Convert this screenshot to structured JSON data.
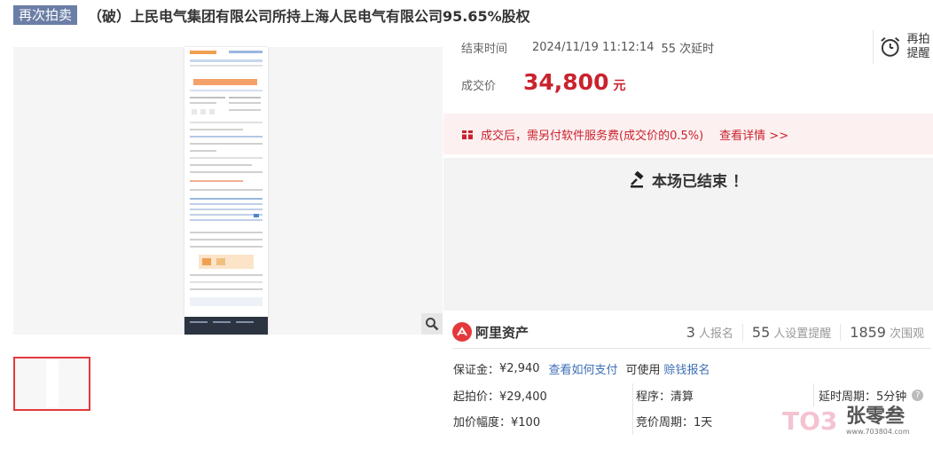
{
  "header": {
    "badge": "再次拍卖",
    "title": "（破）上民电气集团有限公司所持上海人民电气有限公司95.65%股权"
  },
  "auction": {
    "end_label": "结束时间",
    "end_time": "2024/11/19 11:12:14",
    "delay_count": "55 次延时",
    "reminder_label": "再拍提醒",
    "price_label": "成交价",
    "price_value": "34,800",
    "price_unit": "元",
    "fee_notice": "成交后，需另付软件服务费(成交价的0.5%)",
    "fee_link": "查看详情 >>",
    "ended_text": "本场已结束 ！"
  },
  "platform": {
    "name": "阿里资产",
    "stats": [
      {
        "n": "3",
        "u": "人报名"
      },
      {
        "n": "55",
        "u": "人设置提醒"
      },
      {
        "n": "1859",
        "u": "次围观"
      }
    ]
  },
  "details": {
    "deposit_label": "保证金：",
    "deposit_value": "¥2,940",
    "deposit_link": "查看如何支付",
    "usable_text": "可使用",
    "loan_link": "赊钱报名",
    "start_price": "起拍价：¥29,400",
    "procedure": "程序：清算",
    "delay_period": "延时周期：5分钟",
    "increment": "加价幅度：¥100",
    "bid_period": "竞价周期：1天"
  },
  "watermark": {
    "logo": "TO3",
    "name": "张零叁",
    "url": "www.703804.com"
  },
  "colors": {
    "accent": "#c9232f",
    "badge": "#6b7ea6",
    "link": "#3d6fb6"
  }
}
